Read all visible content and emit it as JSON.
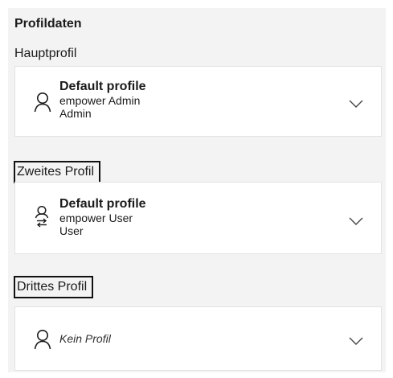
{
  "panel": {
    "title": "Profildaten"
  },
  "main_profile": {
    "section_label": "Hauptprofil",
    "name": "Default profile",
    "user": "empower Admin",
    "role": "Admin",
    "icon": "person-icon"
  },
  "second_profile": {
    "section_label": "Zweites Profil",
    "name": "Default profile",
    "user": "empower User",
    "role": "User",
    "icon": "person-switch-icon"
  },
  "third_profile": {
    "section_label": "Drittes Profil",
    "placeholder": "Kein Profil",
    "icon": "person-icon"
  },
  "colors": {
    "panel_background": "#f3f3f3",
    "card_background": "#ffffff",
    "highlight_border": "#111111"
  }
}
